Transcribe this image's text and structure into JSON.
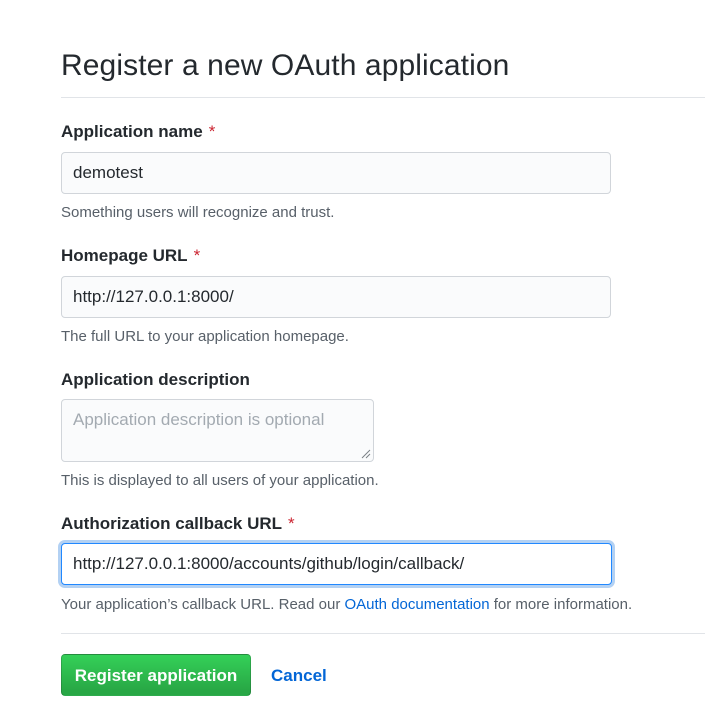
{
  "page": {
    "title": "Register a new OAuth application"
  },
  "form": {
    "required_marker": "*",
    "app_name": {
      "label": "Application name",
      "value": "demotest",
      "note": "Something users will recognize and trust."
    },
    "homepage_url": {
      "label": "Homepage URL",
      "value": "http://127.0.0.1:8000/",
      "note": "The full URL to your application homepage."
    },
    "description": {
      "label": "Application description",
      "value": "",
      "placeholder": "Application description is optional",
      "note": "This is displayed to all users of your application."
    },
    "callback_url": {
      "label": "Authorization callback URL",
      "value": "http://127.0.0.1:8000/accounts/github/login/callback/",
      "note_before": "Your application’s callback URL. Read our ",
      "note_link": "OAuth documentation",
      "note_after": " for more information."
    }
  },
  "actions": {
    "register_label": "Register application",
    "cancel_label": "Cancel"
  },
  "colors": {
    "required": "#cb2431",
    "link": "#0366d6",
    "primary_button": "#2ea44f",
    "focus_border": "#2188ff"
  }
}
